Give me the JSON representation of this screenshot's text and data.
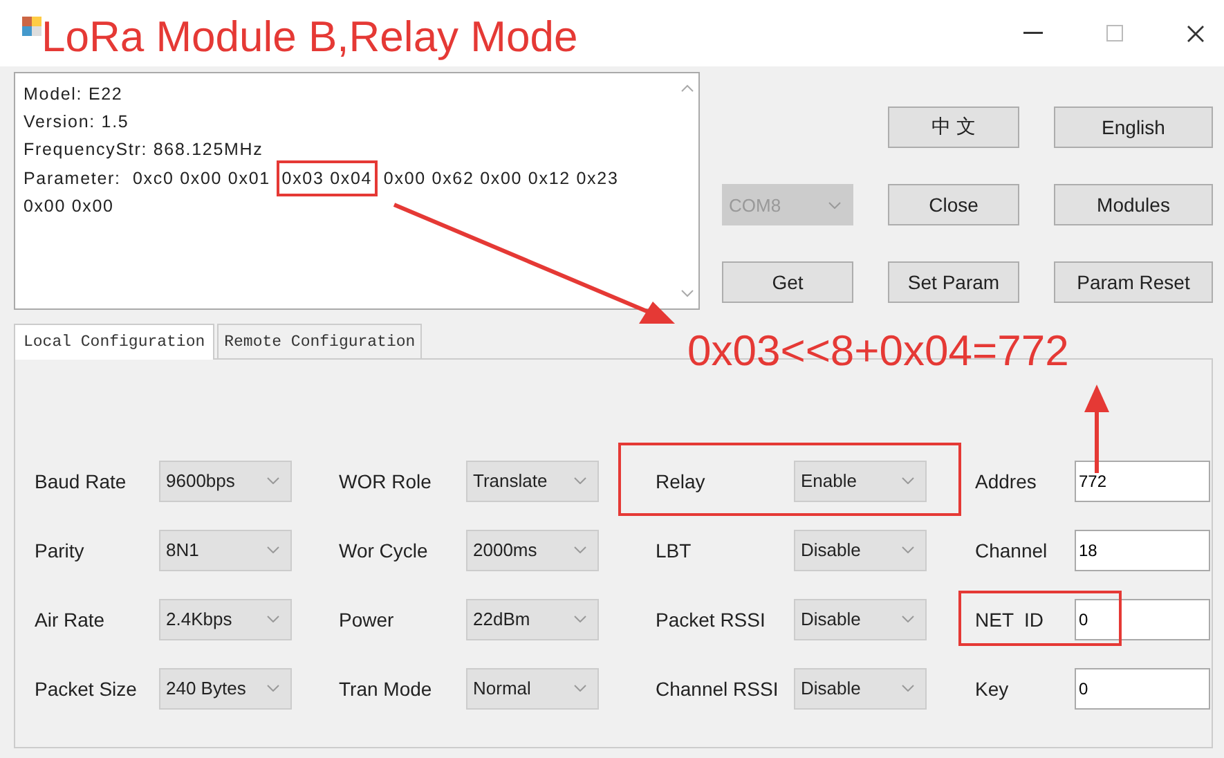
{
  "window": {
    "title": "LoRa Module B,Relay Mode"
  },
  "log": {
    "lines": [
      {
        "segments": [
          {
            "text": "Model: E22",
            "highlighted": false
          }
        ]
      },
      {
        "segments": [
          {
            "text": "Version: 1.5",
            "highlighted": false
          }
        ]
      },
      {
        "segments": [
          {
            "text": "FrequencyStr: 868.125MHz",
            "highlighted": false
          }
        ]
      },
      {
        "segments": [
          {
            "text": "Parameter:  0xc0 0x00 0x01 ",
            "highlighted": false
          },
          {
            "text": "0x03 0x04",
            "highlighted": true
          },
          {
            "text": " 0x00 0x62 0x00 0x12 0x23",
            "highlighted": false
          }
        ]
      },
      {
        "segments": [
          {
            "text": "0x00 0x00",
            "highlighted": false
          }
        ]
      }
    ]
  },
  "control_rows": [
    {
      "cells": [
        {
          "kind": "button",
          "label": "中 文"
        },
        {
          "kind": "button",
          "label": "English"
        }
      ]
    },
    {
      "cells": [
        {
          "kind": "combo",
          "value": "COM8",
          "disabled": true
        },
        {
          "kind": "button",
          "label": "Close"
        },
        {
          "kind": "button",
          "label": "Modules"
        }
      ]
    },
    {
      "cells": [
        {
          "kind": "button",
          "label": "Get"
        },
        {
          "kind": "button",
          "label": "Set Param"
        },
        {
          "kind": "button",
          "label": "Param Reset"
        }
      ]
    }
  ],
  "tabs": [
    {
      "label": "Local Configuration",
      "selected": true
    },
    {
      "label": "Remote Configuration",
      "selected": false
    }
  ],
  "annotation": {
    "formula": "0x03<<8+0x04=772"
  },
  "form_columns": [
    {
      "fields": [
        {
          "label": "Baud Rate",
          "kind": "combo",
          "value": "9600bps",
          "highlighted": false
        },
        {
          "label": "Parity",
          "kind": "combo",
          "value": "8N1",
          "highlighted": false
        },
        {
          "label": "Air Rate",
          "kind": "combo",
          "value": "2.4Kbps",
          "highlighted": false
        },
        {
          "label": "Packet Size",
          "kind": "combo",
          "value": "240 Bytes",
          "highlighted": false
        }
      ]
    },
    {
      "fields": [
        {
          "label": "WOR Role",
          "kind": "combo",
          "value": "Translate",
          "highlighted": false
        },
        {
          "label": "Wor Cycle",
          "kind": "combo",
          "value": "2000ms",
          "highlighted": false
        },
        {
          "label": "Power",
          "kind": "combo",
          "value": "22dBm",
          "highlighted": false
        },
        {
          "label": "Tran Mode",
          "kind": "combo",
          "value": "Normal",
          "highlighted": false
        }
      ]
    },
    {
      "fields": [
        {
          "label": "Relay",
          "kind": "combo",
          "value": "Enable",
          "highlighted": true
        },
        {
          "label": "LBT",
          "kind": "combo",
          "value": "Disable",
          "highlighted": false
        },
        {
          "label": "Packet RSSI",
          "kind": "combo",
          "value": "Disable",
          "highlighted": false
        },
        {
          "label": "Channel RSSI",
          "kind": "combo",
          "value": "Disable",
          "highlighted": false
        }
      ]
    },
    {
      "fields": [
        {
          "label": "Addres",
          "kind": "input",
          "value": "772",
          "highlighted": false
        },
        {
          "label": "Channel",
          "kind": "input",
          "value": "18",
          "highlighted": false
        },
        {
          "label": "NET  ID",
          "kind": "input",
          "value": "0",
          "highlighted": true
        },
        {
          "label": "Key",
          "kind": "input",
          "value": "0",
          "highlighted": false
        }
      ]
    }
  ]
}
